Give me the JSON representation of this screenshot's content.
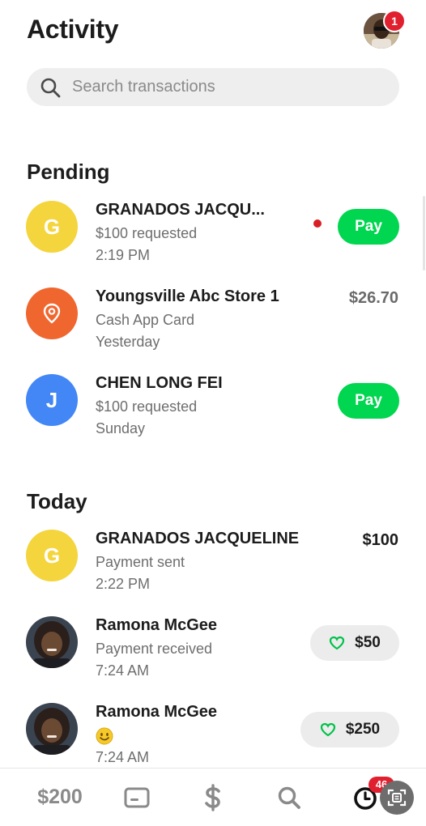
{
  "header": {
    "title": "Activity",
    "notification_count": "1"
  },
  "search": {
    "placeholder": "Search transactions"
  },
  "pending": {
    "title": "Pending",
    "items": [
      {
        "initial": "G",
        "name": "GRANADOS JACQU...",
        "subtitle": "$100 requested",
        "time": "2:19 PM",
        "action_label": "Pay",
        "avatar_color": "#f4d53d"
      },
      {
        "name": "Youngsville Abc Store 1",
        "subtitle": "Cash App Card",
        "time": "Yesterday",
        "amount": "$26.70",
        "avatar_color": "#f0662f",
        "icon": "location-pin-icon"
      },
      {
        "initial": "J",
        "name": "CHEN LONG FEI",
        "subtitle": "$100 requested",
        "time": "Sunday",
        "action_label": "Pay",
        "avatar_color": "#4287f5"
      }
    ]
  },
  "today": {
    "title": "Today",
    "items": [
      {
        "initial": "G",
        "name": "GRANADOS JACQUELINE",
        "subtitle": "Payment sent",
        "time": "2:22 PM",
        "amount": "$100",
        "avatar_color": "#f4d53d"
      },
      {
        "name": "Ramona McGee",
        "subtitle": "Payment received",
        "time": "7:24 AM",
        "amount": "$50",
        "icon": "heart-icon"
      },
      {
        "name": "Ramona McGee",
        "subtitle_icon": "smiley-emoji-icon",
        "time": "7:24 AM",
        "amount": "$250",
        "icon": "heart-icon"
      }
    ]
  },
  "tabbar": {
    "balance": "$200",
    "activity_badge": "46",
    "tabs": [
      "balance",
      "card-icon",
      "dollar-icon",
      "search-icon",
      "activity-clock-icon",
      "qr-scan-icon"
    ]
  },
  "colors": {
    "accent": "#00d64f",
    "badge": "#e0202e",
    "muted_text": "#6e6e6e"
  }
}
